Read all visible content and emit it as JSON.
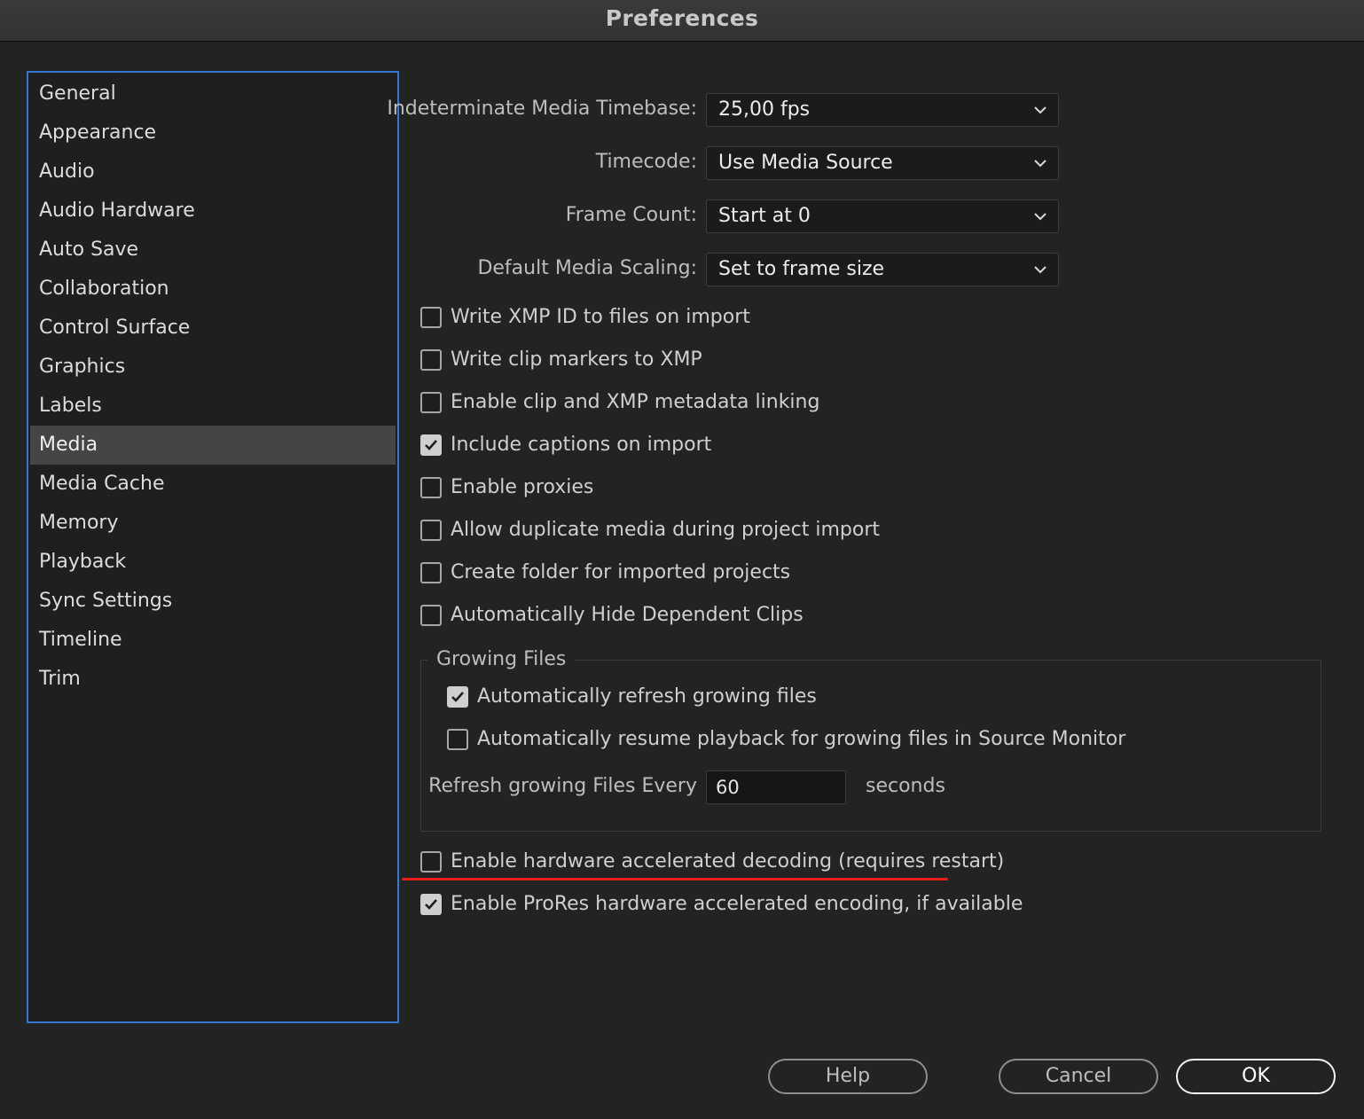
{
  "window": {
    "title": "Preferences"
  },
  "sidebar": {
    "items": [
      {
        "label": "General"
      },
      {
        "label": "Appearance"
      },
      {
        "label": "Audio"
      },
      {
        "label": "Audio Hardware"
      },
      {
        "label": "Auto Save"
      },
      {
        "label": "Collaboration"
      },
      {
        "label": "Control Surface"
      },
      {
        "label": "Graphics"
      },
      {
        "label": "Labels"
      },
      {
        "label": "Media",
        "selected": true
      },
      {
        "label": "Media Cache"
      },
      {
        "label": "Memory"
      },
      {
        "label": "Playback"
      },
      {
        "label": "Sync Settings"
      },
      {
        "label": "Timeline"
      },
      {
        "label": "Trim"
      }
    ]
  },
  "media": {
    "timebase": {
      "label": "Indeterminate Media Timebase:",
      "value": "25,00 fps"
    },
    "timecode": {
      "label": "Timecode:",
      "value": "Use Media Source"
    },
    "frame_count": {
      "label": "Frame Count:",
      "value": "Start at 0"
    },
    "scaling": {
      "label": "Default Media Scaling:",
      "value": "Set to frame size"
    },
    "checkboxes": [
      {
        "label": "Write XMP ID to files on import",
        "checked": false
      },
      {
        "label": "Write clip markers to XMP",
        "checked": false
      },
      {
        "label": "Enable clip and XMP metadata linking",
        "checked": false
      },
      {
        "label": "Include captions on import",
        "checked": true
      },
      {
        "label": "Enable proxies",
        "checked": false
      },
      {
        "label": "Allow duplicate media during project import",
        "checked": false
      },
      {
        "label": "Create folder for imported projects",
        "checked": false
      },
      {
        "label": "Automatically Hide Dependent Clips",
        "checked": false
      }
    ],
    "growing_files": {
      "title": "Growing Files",
      "auto_refresh": {
        "label": "Automatically refresh growing files",
        "checked": true
      },
      "auto_resume": {
        "label": "Automatically resume playback for growing files in Source Monitor",
        "checked": false
      },
      "refresh_label": "Refresh growing Files Every",
      "refresh_value": "60",
      "refresh_unit": "seconds"
    },
    "hw_decoding": {
      "label": "Enable hardware accelerated decoding (requires restart)",
      "checked": false
    },
    "prores_encoding": {
      "label": "Enable ProRes hardware accelerated encoding, if available",
      "checked": true
    }
  },
  "buttons": {
    "help": "Help",
    "cancel": "Cancel",
    "ok": "OK"
  },
  "colors": {
    "sidebar_focus_border": "#2f7ad6",
    "annotation": "#e8201a"
  }
}
